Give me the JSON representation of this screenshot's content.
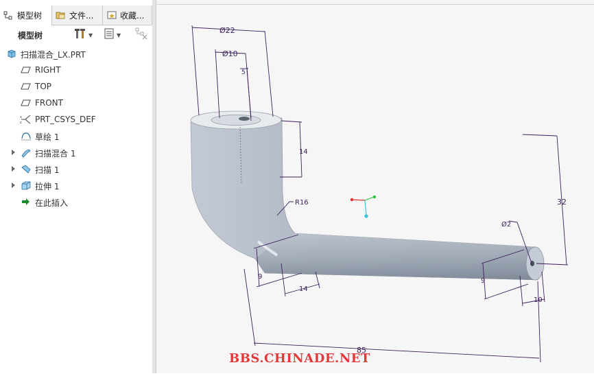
{
  "tabs": [
    {
      "label": "模型树",
      "icon": "model-tree-icon",
      "active": true
    },
    {
      "label": "文件...",
      "icon": "folder-browser-icon",
      "active": false
    },
    {
      "label": "收藏...",
      "icon": "favorites-icon",
      "active": false
    }
  ],
  "toolbar": {
    "title": "模型树",
    "settings_icon": "tools-icon",
    "show_icon": "list-columns-icon",
    "filter_icon": "tree-filter-icon"
  },
  "tree": {
    "root": {
      "label": "扫描混合_LX.PRT",
      "icon": "part-icon"
    },
    "items": [
      {
        "label": "RIGHT",
        "icon": "datum-plane-icon",
        "expandable": false
      },
      {
        "label": "TOP",
        "icon": "datum-plane-icon",
        "expandable": false
      },
      {
        "label": "FRONT",
        "icon": "datum-plane-icon",
        "expandable": false
      },
      {
        "label": "PRT_CSYS_DEF",
        "icon": "coordinate-system-icon",
        "expandable": false
      },
      {
        "label": "草绘 1",
        "icon": "sketch-icon",
        "expandable": false
      },
      {
        "label": "扫描混合 1",
        "icon": "swept-blend-icon",
        "expandable": true
      },
      {
        "label": "扫描 1",
        "icon": "sweep-icon",
        "expandable": true
      },
      {
        "label": "拉伸 1",
        "icon": "extrude-icon",
        "expandable": true
      },
      {
        "label": "在此插入",
        "icon": "insert-here-arrow-icon",
        "expandable": false
      }
    ]
  },
  "viewport": {
    "dimensions": {
      "outer_diameter": "Ø22",
      "inner_diameter": "Ø10",
      "chamfer": "5",
      "vertical_length": "14",
      "bend_radius": "R16",
      "height": "32",
      "tip_diameter": "Ø2",
      "section_a": "9",
      "section_a_length": "14",
      "section_b": "9",
      "tip_length": "10",
      "total_length": "85"
    },
    "colors": {
      "model": "#a9b2bf",
      "dimension": "#3c1f5a",
      "csys_x": "#e03030",
      "csys_y": "#30c040",
      "csys_z": "#30c8d8"
    }
  },
  "watermark": "BBS.CHINADE.NET"
}
